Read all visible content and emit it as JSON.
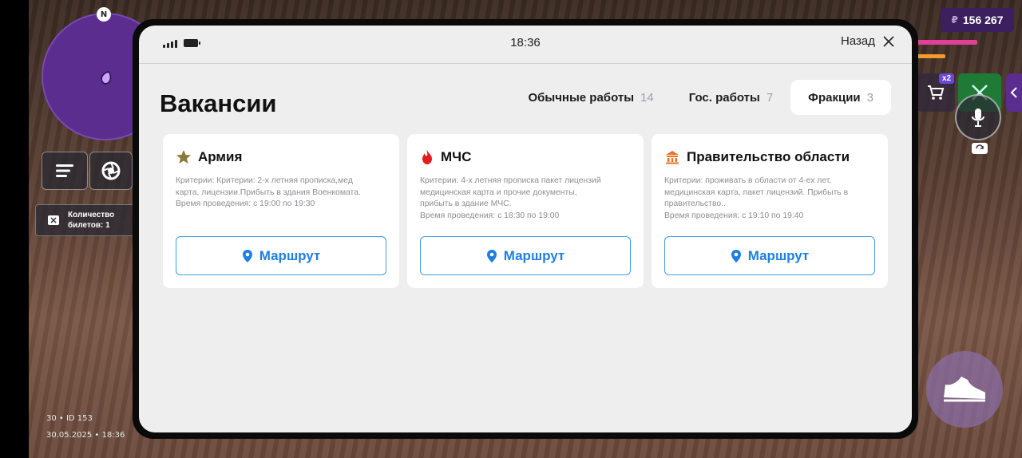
{
  "hud": {
    "compass": "N",
    "tickets_label": "Количество\nбилетов: 1",
    "player_info": "30 • ID 153",
    "datetime": "30.05.2025 • 18:36",
    "money_symbol": "₽",
    "money": "156 267",
    "multiplier": "x2",
    "accent_color": "#5b2d8e"
  },
  "tablet": {
    "clock": "18:36",
    "back_label": "Назад",
    "title": "Вакансии",
    "tabs": [
      {
        "label": "Обычные работы",
        "count": "14"
      },
      {
        "label": "Гос. работы",
        "count": "7"
      },
      {
        "label": "Фракции",
        "count": "3",
        "active": true
      }
    ],
    "cards": [
      {
        "icon": "star-icon",
        "title": "Армия",
        "description": "Критерии: Критерии: 2-х летняя прописка,мед\nкарта, лицензии.Прибыть в здания Военкомата.\nВремя проведения: с 19:00 по 19:30",
        "button": "Маршрут"
      },
      {
        "icon": "flame-icon",
        "title": "МЧС",
        "description": "Критерии: 4-х летняя прописка пакет лицензий\nмедицинская карта и прочие документы,\nприбыть в здание МЧС.\nВремя проведения: с 18:30 по 19:00",
        "button": "Маршрут"
      },
      {
        "icon": "government-building-icon",
        "title": "Правительство области",
        "description": "Критерии: проживать в области от 4-ех лет,\nмедицинская карта, пакет лицензий. Прибыть в\nправительство..\nВремя проведения: с 19:10 по 19:40",
        "button": "Маршрут"
      }
    ],
    "route_color": "#1f7fe0"
  }
}
